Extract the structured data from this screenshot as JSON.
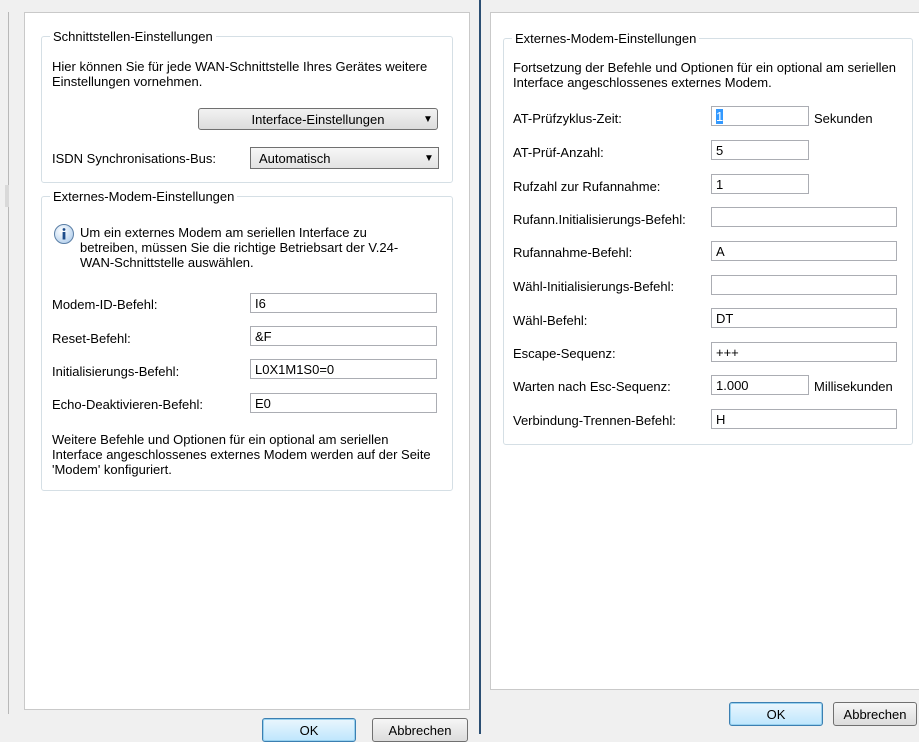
{
  "left": {
    "interface_group": {
      "legend": "Schnittstellen-Einstellungen",
      "description": "Hier können Sie für jede WAN-Schnittstelle Ihres Gerätes weitere Einstellungen vornehmen.",
      "interface_button_label": "Interface-Einstellungen",
      "isdn_label": "ISDN Synchronisations-Bus:",
      "isdn_value": "Automatisch"
    },
    "modem_group": {
      "legend": "Externes-Modem-Einstellungen",
      "info_text": "Um ein externes Modem am seriellen Interface zu betreiben, müssen Sie die richtige Betriebsart der V.24-WAN-Schnittstelle auswählen.",
      "fields": [
        {
          "label": "Modem-ID-Befehl:",
          "value": "I6"
        },
        {
          "label": "Reset-Befehl:",
          "value": "&F"
        },
        {
          "label": "Initialisierungs-Befehl:",
          "value": "L0X1M1S0=0"
        },
        {
          "label": "Echo-Deaktivieren-Befehl:",
          "value": "E0"
        }
      ],
      "footer_text": "Weitere Befehle und Optionen für ein optional am seriellen Interface angeschlossenes externes Modem werden auf der Seite 'Modem' konfiguriert."
    },
    "ok_label": "OK",
    "cancel_label": "Abbrechen"
  },
  "right": {
    "modem_group": {
      "legend": "Externes-Modem-Einstellungen",
      "description": "Fortsetzung der Befehle und Optionen für ein optional am seriellen Interface angeschlossenes externes Modem.",
      "fields": [
        {
          "label": "AT-Prüfzyklus-Zeit:",
          "value": "1",
          "unit": "Sekunden"
        },
        {
          "label": "AT-Prüf-Anzahl:",
          "value": "5",
          "unit": ""
        },
        {
          "label": "Rufzahl zur Rufannahme:",
          "value": "1",
          "unit": ""
        },
        {
          "label": "Rufann.Initialisierungs-Befehl:",
          "value": "",
          "unit": ""
        },
        {
          "label": "Rufannahme-Befehl:",
          "value": "A",
          "unit": ""
        },
        {
          "label": "Wähl-Initialisierungs-Befehl:",
          "value": "",
          "unit": ""
        },
        {
          "label": "Wähl-Befehl:",
          "value": "DT",
          "unit": ""
        },
        {
          "label": "Escape-Sequenz:",
          "value": "+++",
          "unit": ""
        },
        {
          "label": "Warten nach Esc-Sequenz:",
          "value": "1.000",
          "unit": "Millisekunden"
        },
        {
          "label": "Verbindung-Trennen-Befehl:",
          "value": "H",
          "unit": ""
        }
      ]
    },
    "ok_label": "OK",
    "cancel_label": "Abbrechen"
  },
  "colors": {
    "divider": "#2b4f73",
    "selection": "#3399ff"
  }
}
